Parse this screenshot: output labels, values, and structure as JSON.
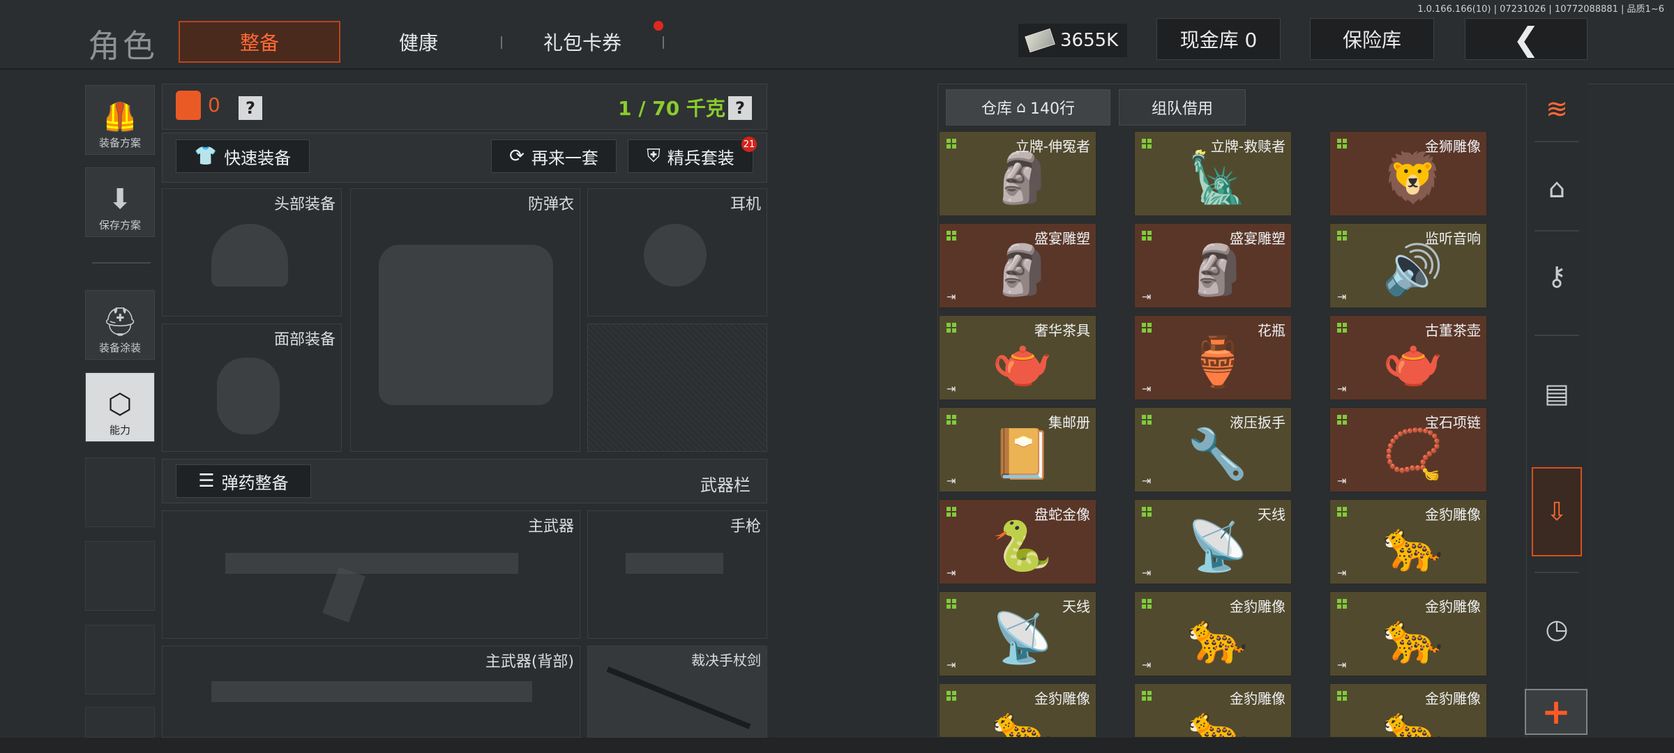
{
  "build_info": "1.0.166.166(10) | 07231026 | 10772088881 | 品质1~6",
  "page_title": "角色",
  "tabs": [
    {
      "label": "整备",
      "active": true
    },
    {
      "label": "健康",
      "active": false
    },
    {
      "label": "礼包卡券",
      "active": false
    }
  ],
  "currency": {
    "amount": "3655K",
    "icon": "cash-icon"
  },
  "cash_vault": "现金库 0",
  "safe_vault": "保险库",
  "back": "❮",
  "sidebar": [
    {
      "label": "装备方案",
      "icon": "vest-icon"
    },
    {
      "label": "保存方案",
      "icon": "download-icon"
    },
    {
      "label": "装备涂装",
      "icon": "helmet-paint-icon"
    },
    {
      "label": "能力",
      "icon": "ability-icon",
      "active": true
    }
  ],
  "loadout": {
    "vest_count": "0",
    "help": "?",
    "weight": "1 / 70 千克",
    "quick_equip": "快速装备",
    "repeat": "再来一套",
    "elite": "精兵套装",
    "elite_badge": "21",
    "slots": {
      "head": "头部装备",
      "armor": "防弹衣",
      "headset": "耳机",
      "face": "面部装备"
    },
    "ammo": "弹药整备",
    "weapon_bar": "武器栏",
    "weapons": {
      "primary": "主武器",
      "pistol": "手枪",
      "primary_back": "主武器(背部)",
      "melee": "裁决手杖剑"
    }
  },
  "warehouse": {
    "tab_label": "仓库",
    "rows": "140行",
    "team_borrow": "组队借用",
    "items": [
      {
        "name": "立牌-伸冤者",
        "tone": "olive",
        "icon": "🗿"
      },
      {
        "name": "立牌-救赎者",
        "tone": "olive",
        "icon": "🗽"
      },
      {
        "name": "金狮雕像",
        "tone": "brown",
        "icon": "🦁"
      },
      {
        "name": "盛宴雕塑",
        "tone": "brown",
        "icon": "🗿"
      },
      {
        "name": "盛宴雕塑",
        "tone": "brown",
        "icon": "🗿"
      },
      {
        "name": "监听音响",
        "tone": "olive",
        "icon": "🔊"
      },
      {
        "name": "奢华茶具",
        "tone": "olive",
        "icon": "🫖"
      },
      {
        "name": "花瓶",
        "tone": "brown",
        "icon": "🏺"
      },
      {
        "name": "古董茶壶",
        "tone": "brown",
        "icon": "🫖"
      },
      {
        "name": "集邮册",
        "tone": "olive",
        "icon": "📔"
      },
      {
        "name": "液压扳手",
        "tone": "olive",
        "icon": "🔧"
      },
      {
        "name": "宝石项链",
        "tone": "brown",
        "icon": "📿"
      },
      {
        "name": "盘蛇金像",
        "tone": "brown",
        "icon": "🐍"
      },
      {
        "name": "天线",
        "tone": "olive",
        "icon": "📡"
      },
      {
        "name": "金豹雕像",
        "tone": "olive",
        "icon": "🐆"
      },
      {
        "name": "天线",
        "tone": "olive",
        "icon": "📡"
      },
      {
        "name": "金豹雕像",
        "tone": "olive",
        "icon": "🐆"
      },
      {
        "name": "金豹雕像",
        "tone": "olive",
        "icon": "🐆"
      },
      {
        "name": "金豹雕像",
        "tone": "olive",
        "icon": "🐆"
      },
      {
        "name": "金豹雕像",
        "tone": "olive",
        "icon": "🐆"
      },
      {
        "name": "金豹雕像",
        "tone": "olive",
        "icon": "🐆"
      }
    ]
  },
  "rail_icons": [
    "stack-refresh-icon",
    "home-icon",
    "key-icon",
    "cash-stack-icon",
    "box-download-icon",
    "clock-icon"
  ],
  "plus": "+",
  "colors": {
    "accent": "#ea5a25",
    "weight_green": "#8ccc2e",
    "item_olive": "#524a2e",
    "item_brown": "#5a3628"
  }
}
